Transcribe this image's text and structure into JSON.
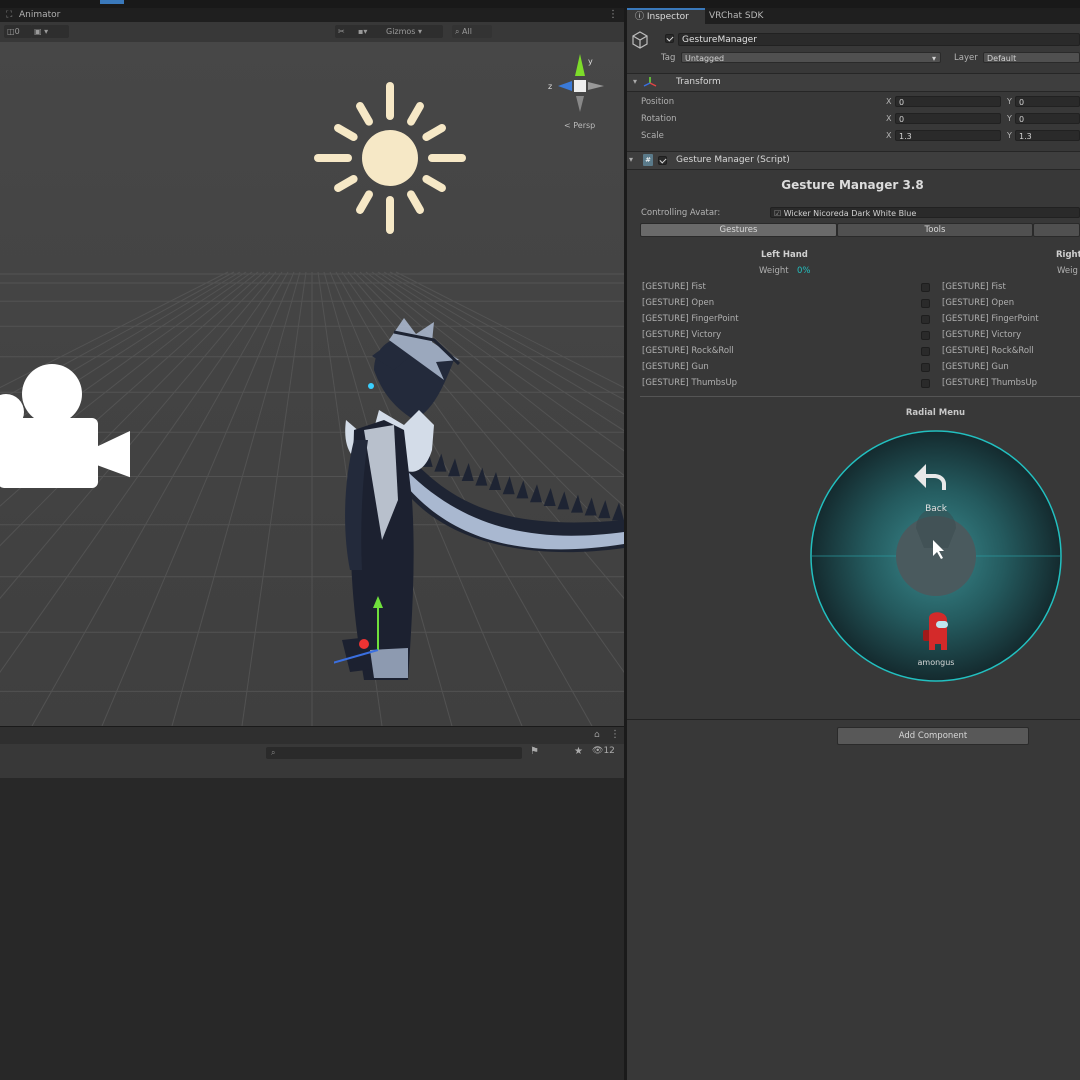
{
  "scene": {
    "tab_label": "Animator",
    "toolbar": {
      "gizmos_label": "Gizmos",
      "search_placeholder": "All",
      "layers_count": "0"
    },
    "persp_label": "< Persp",
    "axis": {
      "x": "x",
      "y": "y",
      "z": "z"
    },
    "console_visible_count": "12"
  },
  "inspector": {
    "tabs": [
      "Inspector",
      "VRChat SDK"
    ],
    "object": {
      "name": "GestureManager",
      "tag_label": "Tag",
      "tag_value": "Untagged",
      "layer_label": "Layer",
      "layer_value": "Default"
    },
    "transform": {
      "title": "Transform",
      "rows": [
        {
          "label": "Position",
          "x": "0",
          "y": "0"
        },
        {
          "label": "Rotation",
          "x": "0",
          "y": "0"
        },
        {
          "label": "Scale",
          "x": "1.3",
          "y": "1.3"
        }
      ],
      "x_label": "X",
      "y_label": "Y"
    },
    "script": {
      "header": "Gesture Manager (Script)",
      "title": "Gesture Manager 3.8",
      "controlling_label": "Controlling Avatar:",
      "controlling_value": "Wicker Nicoreda Dark White Blue",
      "tabs": [
        "Gestures",
        "Tools"
      ],
      "left_hand": {
        "title": "Left Hand",
        "weight_label": "Weight",
        "weight_value": "0%"
      },
      "right_hand": {
        "title": "Right",
        "weight_label": "Weig"
      },
      "gestures_left": [
        "[GESTURE] Fist",
        "[GESTURE] Open",
        "[GESTURE] FingerPoint",
        "[GESTURE] Victory",
        "[GESTURE] Rock&Roll",
        "[GESTURE] Gun",
        "[GESTURE] ThumbsUp"
      ],
      "gestures_right": [
        "[GESTURE] Fist",
        "[GESTURE] Open",
        "[GESTURE] FingerPoint",
        "[GESTURE] Victory",
        "[GESTURE] Rock&Roll",
        "[GESTURE] Gun",
        "[GESTURE] ThumbsUp"
      ],
      "radial_title": "Radial Menu",
      "radial_top_label": "Back",
      "radial_bottom_label": "amongus"
    },
    "add_component_label": "Add Component"
  },
  "colors": {
    "accent_teal": "#22c0c0",
    "selection_blue": "#3a79bb",
    "amongus_red": "#d42a2a"
  }
}
